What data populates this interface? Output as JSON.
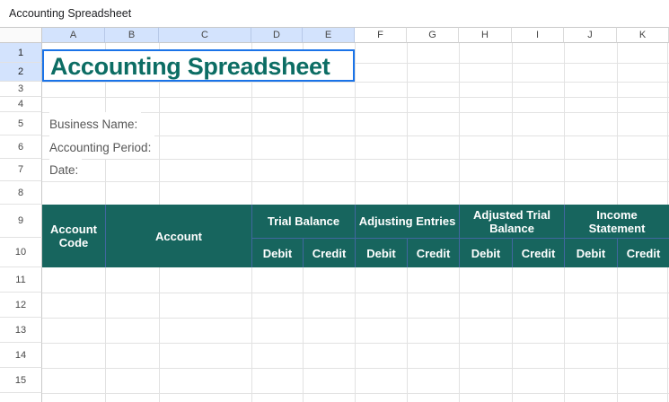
{
  "topbar": {
    "file_title": "Accounting Spreadsheet"
  },
  "columns": [
    "A",
    "B",
    "C",
    "D",
    "E",
    "F",
    "G",
    "H",
    "I",
    "J",
    "K"
  ],
  "rows": [
    "1",
    "2",
    "3",
    "4",
    "5",
    "6",
    "7",
    "8",
    "9",
    "10",
    "11",
    "12",
    "13",
    "14",
    "15"
  ],
  "sheet": {
    "title_cell": "Accounting Spreadsheet",
    "labels": {
      "business_name": "Business Name:",
      "accounting_period": "Accounting Period:",
      "date": "Date:"
    },
    "table": {
      "account_code": "Account Code",
      "account": "Account",
      "groups": [
        {
          "label": "Trial Balance"
        },
        {
          "label": "Adjusting Entries"
        },
        {
          "label": "Adjusted Trial Balance"
        },
        {
          "label": "Income Statement"
        }
      ],
      "debit": "Debit",
      "credit": "Credit"
    }
  },
  "colors": {
    "teal_fill": "#17655e",
    "teal_cell_border": "#41669f",
    "title_text": "#0c6d64",
    "selection_border": "#1a73e8",
    "selected_header_bg": "#d3e3fd",
    "gridline": "#e2e2e2"
  }
}
